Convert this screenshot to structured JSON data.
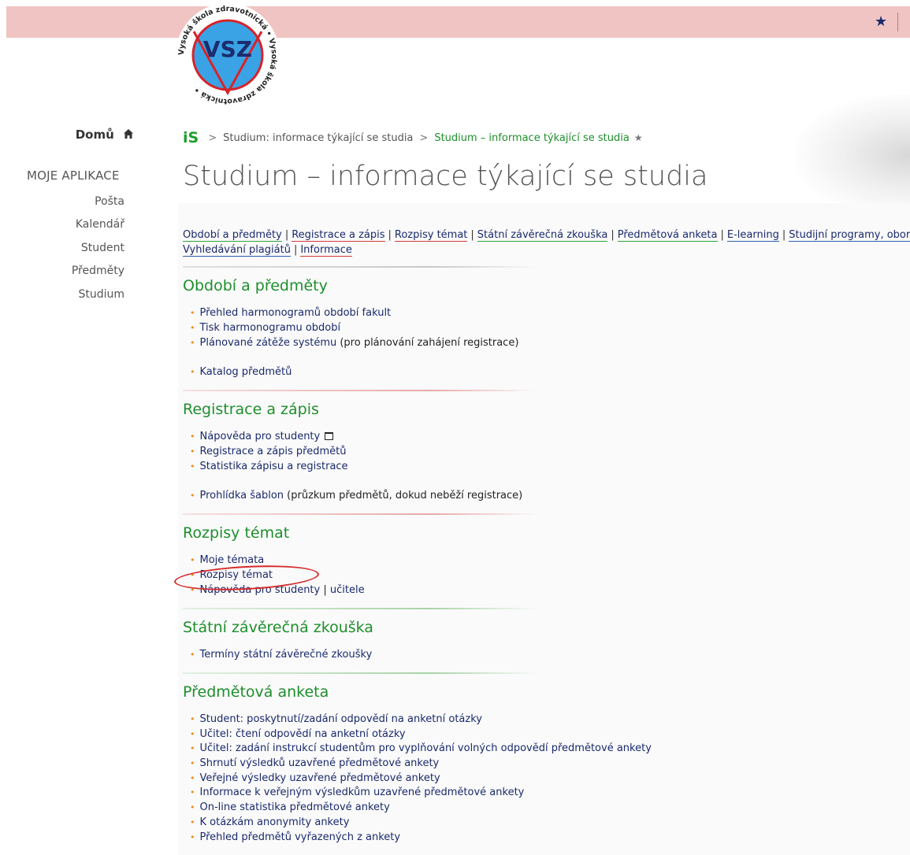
{
  "logo": {
    "text": "VSZ",
    "ring_text": "Vysoká škola zdravotnická • Vysoká škola zdravotnická •"
  },
  "sidebar": {
    "home_label": "Domů",
    "apps_title": "MOJE APLIKACE",
    "items": [
      {
        "label": "Pošta"
      },
      {
        "label": "Kalendář"
      },
      {
        "label": "Student"
      },
      {
        "label": "Předměty"
      },
      {
        "label": "Studium"
      }
    ]
  },
  "breadcrumb": {
    "root": "iS",
    "separator": ">",
    "items": [
      "Studium: informace týkající se studia",
      "Studium – informace týkající se studia"
    ],
    "pin": "★"
  },
  "page": {
    "title": "Studium – informace týkající se studia"
  },
  "nav": {
    "row1": [
      "Období a předměty",
      "Registrace a zápis",
      "Rozpisy témat",
      "Státní závěrečná zkouška",
      "Předmětová anketa",
      "E-learning",
      "Studijní programy, obory"
    ],
    "row2": [
      "Vyhledávání plagiátů",
      "Informace"
    ],
    "separator": "|"
  },
  "sections": {
    "obdobi": {
      "title": "Období a předměty",
      "items": [
        {
          "link": "Přehled harmonogramů období fakult"
        },
        {
          "link": "Tisk harmonogramu období"
        },
        {
          "link": "Plánované zátěže systému",
          "note": " (pro plánování zahájení registrace)"
        },
        {
          "link": "Katalog předmětů"
        }
      ]
    },
    "registrace": {
      "title": "Registrace a zápis",
      "items": [
        {
          "link": "Nápověda pro studenty"
        },
        {
          "link": "Registrace a zápis předmětů"
        },
        {
          "link": "Statistika zápisu a registrace"
        },
        {
          "link": "Prohlídka šablon",
          "note": " (průzkum předmětů, dokud neběží registrace)"
        }
      ]
    },
    "rozpisy": {
      "title": "Rozpisy témat",
      "items": [
        {
          "link": "Moje témata"
        },
        {
          "link": "Rozpisy témat"
        },
        {
          "link": "Nápověda pro studenty",
          "sep": " | ",
          "link2": "učitele"
        }
      ]
    },
    "szz": {
      "title": "Státní závěrečná zkouška",
      "items": [
        {
          "link": "Termíny státní závěrečné zkoušky"
        }
      ]
    },
    "anketa": {
      "title": "Předmětová anketa",
      "items": [
        {
          "link": "Student: poskytnutí/zadání odpovědí na anketní otázky"
        },
        {
          "link": "Učitel: čtení odpovědí na anketní otázky"
        },
        {
          "link": "Učitel: zadání instrukcí studentům pro vyplňování volných odpovědí předmětové ankety"
        },
        {
          "link": "Shrnutí výsledků uzavřené předmětové ankety"
        },
        {
          "link": "Veřejné výsledky uzavřené předmětové ankety"
        },
        {
          "link": "Informace k veřejným výsledkům uzavřené předmětové ankety"
        },
        {
          "link": "On-line statistika předmětové ankety"
        },
        {
          "link": "K otázkám anonymity ankety"
        },
        {
          "link": "Přehled předmětů vyřazených z ankety"
        }
      ]
    }
  },
  "colors": {
    "topbar": "#f0c4c2",
    "section_title": "#1e8f2c",
    "link": "#1a2a6c",
    "bullet": "#f08a1c",
    "annotation": "#d62a2a"
  }
}
